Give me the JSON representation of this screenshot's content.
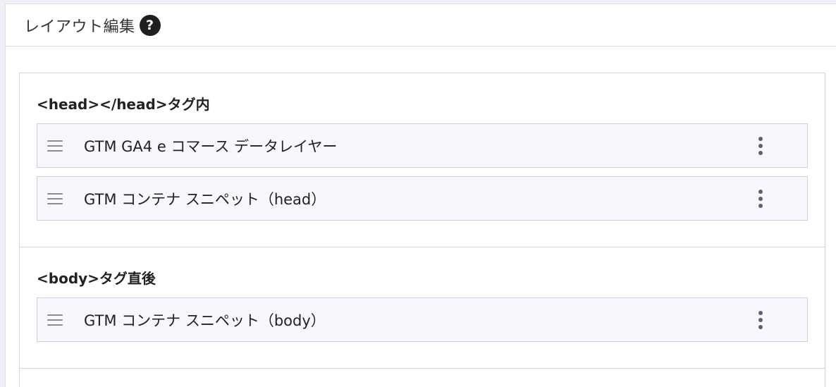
{
  "panel": {
    "title": "レイアウト編集",
    "help_icon": "?"
  },
  "sections": [
    {
      "title": "<head></head>タグ内",
      "items": [
        {
          "label": "GTM GA4 e コマース データレイヤー"
        },
        {
          "label": "GTM コンテナ スニペット（head）"
        }
      ]
    },
    {
      "title": "<body>タグ直後",
      "items": [
        {
          "label": "GTM コンテナ スニペット（body）"
        }
      ]
    }
  ],
  "icons": {
    "help": "question-circle-icon",
    "drag": "drag-handle-icon",
    "menu": "kebab-menu-icon"
  }
}
